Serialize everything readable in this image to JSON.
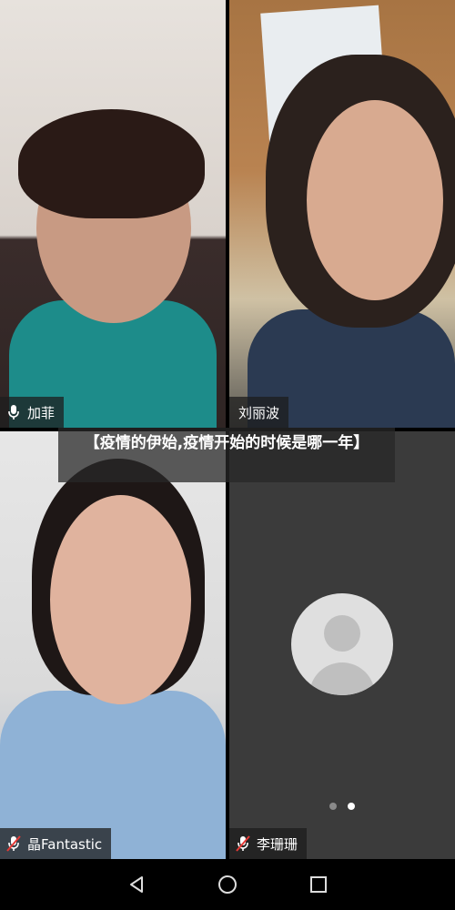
{
  "participants": [
    {
      "name": "加菲",
      "mic": "mic-on"
    },
    {
      "name": "刘丽波",
      "mic": "none"
    },
    {
      "name": "晶Fantastic",
      "mic": "mic-muted"
    },
    {
      "name": "李珊珊",
      "mic": "mic-muted"
    }
  ],
  "subtitle": "【疫情的伊始,疫情开始的时候是哪一年】",
  "page_indicator": {
    "count": 2,
    "active": 2
  },
  "nav": {
    "back": "back-icon",
    "home": "home-icon",
    "recents": "recents-icon"
  }
}
